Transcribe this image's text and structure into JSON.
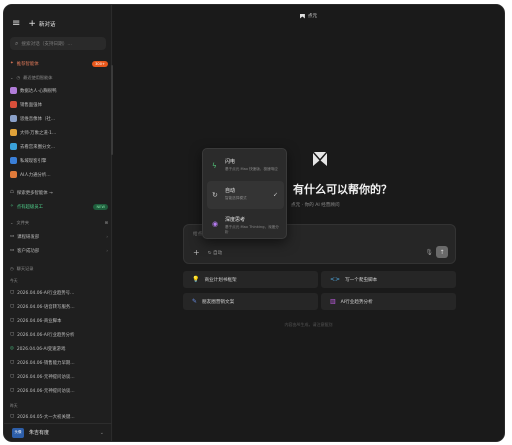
{
  "topbar": {
    "title": "点元"
  },
  "sidebar": {
    "new_chat": "新对话",
    "search_placeholder": "搜索对话（支持日期）…",
    "featured": {
      "label": "推荐智能体",
      "badge": "300+"
    },
    "recent_section": "最近使用智能体",
    "agents": [
      {
        "label": "数据达人·心胸很鸭",
        "color": "#b07cd8"
      },
      {
        "label": "销售面强体",
        "color": "#d84f3a"
      },
      {
        "label": "思维音像体（社…",
        "color": "#8aa0c8"
      },
      {
        "label": "大师·万象之道·1…",
        "color": "#e0a23a"
      },
      {
        "label": "去看宫来圈分文…",
        "color": "#3aa0d8"
      },
      {
        "label": "私域现客引擎",
        "color": "#3a7fd8"
      },
      {
        "label": "AI人力通分析…",
        "color": "#e07a3a"
      }
    ],
    "explore": "探索更多智能体 →",
    "digital_employee": {
      "label": "点有超级员工",
      "badge": "NEW"
    },
    "files_section": "文件夹",
    "folders": [
      "课程研发部",
      "客户成功部"
    ],
    "history_section": "聊天记录",
    "today_label": "今天",
    "history": [
      "2026.04.06-AI行业趋势号…",
      "2026.04.06-语音转写服务…",
      "2026.04.06-商业脚本",
      "2026.04.06-AI行业趋势分析",
      "2026.04.06-AI变速游戏",
      "2026.04.06-销售能力早期…",
      "2026.04.06-元神提问访谈…",
      "2026.04.06-元神提问访谈…"
    ],
    "earlier_label": "昨天",
    "history_earlier": [
      "2026.04.05-大一大初关键…"
    ],
    "user": {
      "name": "朱吉有度",
      "avatar_text": "头像"
    }
  },
  "main": {
    "hero_title": "有什么可以帮你的？",
    "subtitle": "点元 · 你的 AI 经营顾问",
    "composer_placeholder": "给点元…",
    "mode_label": "自动",
    "suggestions": [
      {
        "label": "商业计划书框架",
        "icon": "lightbulb-icon",
        "color": "#e9b23a"
      },
      {
        "label": "写一个爬虫脚本",
        "icon": "code-icon",
        "color": "#4fa9e0"
      },
      {
        "label": "朋友圈营销文案",
        "icon": "pen-icon",
        "color": "#6a8fe8"
      },
      {
        "label": "AI行业趋势分析",
        "icon": "chart-icon",
        "color": "#c45ee8"
      }
    ],
    "footer_note": "内容由AI生成，请注意甄别"
  },
  "mode_menu": {
    "items": [
      {
        "name": "闪电",
        "desc": "基于点元 Max 快速版，极速响应",
        "icon_color": "#52c87a",
        "active": false
      },
      {
        "name": "自动",
        "desc": "智能选择模式",
        "icon_color": "#c8c8c8",
        "active": true
      },
      {
        "name": "深度思考",
        "desc": "基于点元 Max Thinking，深度分析",
        "icon_color": "#b57bf0",
        "active": false
      }
    ]
  }
}
